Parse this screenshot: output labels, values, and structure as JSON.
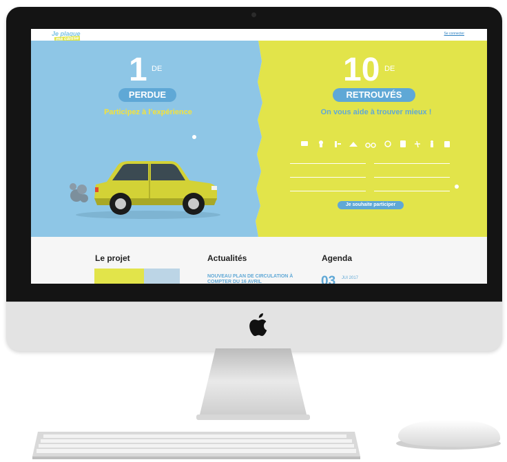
{
  "site": {
    "logo_line1": "Je plaque",
    "logo_line2": "ma caisse",
    "login_link": "Se connecter"
  },
  "hero_left": {
    "number": "1",
    "de": "DE",
    "badge": "PERDUE",
    "headline": "Participez à l’expérience",
    "line1": "",
    "line2": "",
    "line3": ""
  },
  "hero_right": {
    "number": "10",
    "de": "DE",
    "badge": "RETROUVÉS",
    "headline": "On vous aide à trouver mieux !",
    "intro1": "",
    "intro2": "",
    "fields": [
      {
        "label": ""
      },
      {
        "label": ""
      },
      {
        "label": ""
      },
      {
        "label": ""
      },
      {
        "label": ""
      },
      {
        "label": ""
      }
    ],
    "submit_button": "Je souhaite participer",
    "footnote1": "",
    "footnote2": "",
    "footnote3": ""
  },
  "sections": {
    "projet": "Le projet",
    "actualites": "Actualités",
    "agenda": "Agenda",
    "news_title": "NOUVEAU PLAN DE CIRCULATION À COMPTER DU 16 AVRIL",
    "agenda_day": "03",
    "agenda_month": "JUI 2017"
  },
  "colors": {
    "blue": "#8ec6e6",
    "yellow": "#e2e44a",
    "accent_blue": "#5fa8d6",
    "car": "#d3d236"
  }
}
